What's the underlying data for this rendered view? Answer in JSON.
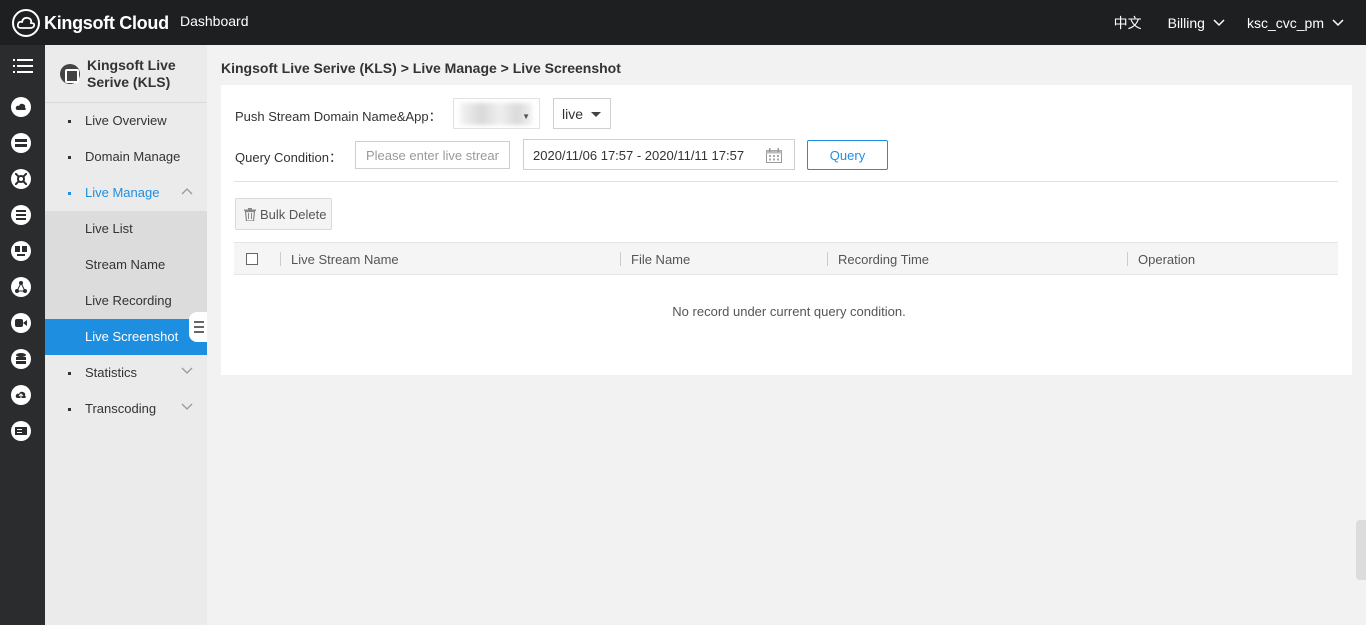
{
  "header": {
    "brand": "Kingsoft Cloud",
    "dashboard": "Dashboard",
    "language": "中文",
    "billing": "Billing",
    "account": "ksc_cvc_pm"
  },
  "rail": {
    "icons": [
      "menu-icon",
      "cloud-icon",
      "network-icon",
      "cdn-icon",
      "database-icon",
      "monitor-icon",
      "relation-icon",
      "video-icon",
      "storage-icon",
      "upload-icon",
      "ticket-icon"
    ]
  },
  "sidebar": {
    "title": "Kingsoft Live Serive (KLS)",
    "items": [
      {
        "label": "Live Overview"
      },
      {
        "label": "Domain Manage"
      },
      {
        "label": "Live Manage"
      },
      {
        "label": "Live List"
      },
      {
        "label": "Stream Name"
      },
      {
        "label": "Live Recording"
      },
      {
        "label": "Live Screenshot"
      },
      {
        "label": "Statistics"
      },
      {
        "label": "Transcoding"
      }
    ]
  },
  "breadcrumb": "Kingsoft Live Serive (KLS) > Live Manage > Live Screenshot",
  "filters": {
    "domain_label": "Push Stream Domain Name&App：",
    "app_value": "live",
    "query_label": "Query Condition：",
    "search_placeholder": "Please enter live stream name",
    "date_range": "2020/11/06 17:57 - 2020/11/11 17:57",
    "query_button": "Query"
  },
  "toolbar": {
    "bulk_delete": "Bulk Delete"
  },
  "table": {
    "columns": [
      "Live Stream Name",
      "File Name",
      "Recording Time",
      "Operation"
    ],
    "empty_text": "No record under current query condition."
  }
}
